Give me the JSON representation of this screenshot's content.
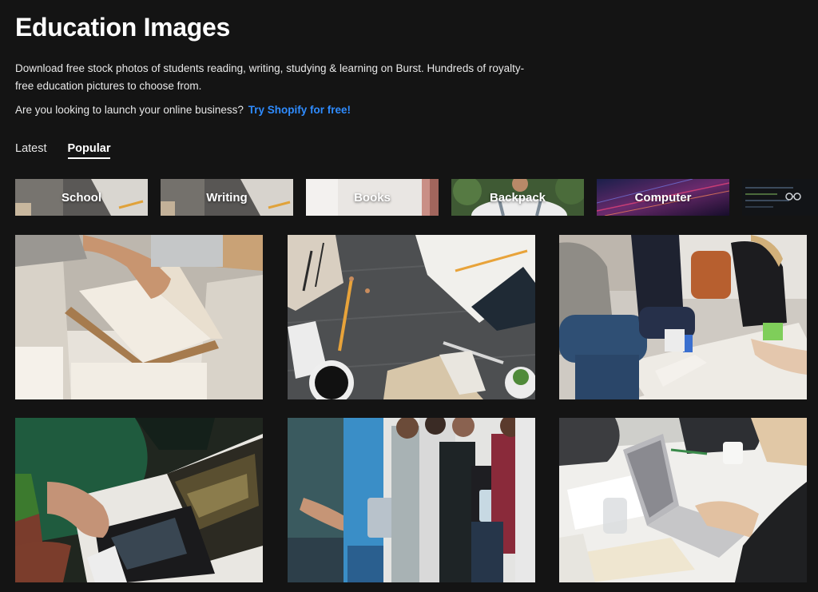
{
  "header": {
    "title": "Education Images",
    "description": "Download free stock photos of students reading, writing, studying & learning on Burst. Hundreds of royalty-free education pictures to choose from.",
    "promo_text": "Are you looking to launch your online business?",
    "promo_link": "Try Shopify for free!"
  },
  "tabs": [
    {
      "label": "Latest",
      "active": false
    },
    {
      "label": "Popular",
      "active": true
    }
  ],
  "categories": [
    {
      "label": "School"
    },
    {
      "label": "Writing"
    },
    {
      "label": "Books"
    },
    {
      "label": "Backpack"
    },
    {
      "label": "Computer"
    },
    {
      "label": "",
      "icon": "glasses-icon"
    }
  ],
  "photos": [
    {
      "name": "photo-open-books"
    },
    {
      "name": "photo-desk-supplies"
    },
    {
      "name": "photo-students-table"
    },
    {
      "name": "photo-magazine-reading"
    },
    {
      "name": "photo-students-standing"
    },
    {
      "name": "photo-laptop-desk"
    }
  ],
  "colors": {
    "background": "#141414",
    "link": "#2f8cff",
    "text": "#ffffff"
  }
}
